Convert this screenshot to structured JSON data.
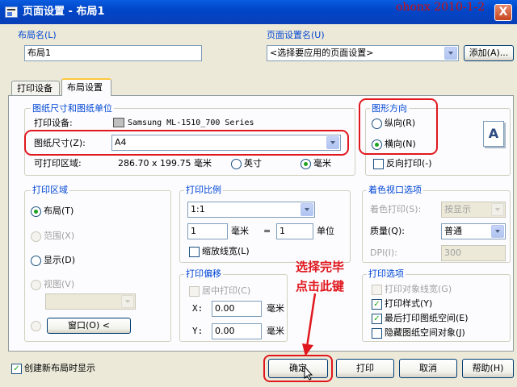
{
  "window": {
    "title": "页面设置 - 布局1",
    "watermark": "ohonx 2010-1-2",
    "close_glyph": "X"
  },
  "layout_name": {
    "label": "布局名(L)",
    "value": "布局1"
  },
  "page_setup_name": {
    "label": "页面设置名(U)",
    "selected": "<选择要应用的页面设置>",
    "add_button": "添加(A)..."
  },
  "tabs": [
    {
      "label": "打印设备",
      "active": false
    },
    {
      "label": "布局设置",
      "active": true
    }
  ],
  "paper": {
    "group_label": "图纸尺寸和图纸单位",
    "device_label": "打印设备:",
    "device_value": "Samsung ML-1510_700 Series",
    "size_label": "图纸尺寸(Z):",
    "size_value": "A4",
    "printable_label": "可打印区域:",
    "printable_value": "286.70 x 199.75 毫米",
    "unit_inch": "英寸",
    "unit_mm": "毫米",
    "selected_unit": "mm"
  },
  "orientation": {
    "group_label": "图形方向",
    "portrait": "纵向(R)",
    "landscape": "横向(N)",
    "selected": "landscape",
    "reverse": "反向打印(-)",
    "preview_glyph": "A"
  },
  "print_area": {
    "group_label": "打印区域",
    "options": [
      "布局(T)",
      "范围(X)",
      "显示(D)",
      "视图(V)"
    ],
    "selected": "布局(T)",
    "window_button": "窗口(O) <"
  },
  "print_scale": {
    "group_label": "打印比例",
    "ratio": "1:1",
    "value1": "1",
    "unit1": "毫米",
    "equals": "=",
    "value2": "1",
    "unit2": "单位",
    "scale_lineweights": "缩放线宽(L)"
  },
  "offset": {
    "group_label": "打印偏移",
    "center": "居中打印(C)",
    "x_label": "X:",
    "x_value": "0.00",
    "y_label": "Y:",
    "y_value": "0.00",
    "unit": "毫米"
  },
  "shaded": {
    "group_label": "着色视口选项",
    "shade_label": "着色打印(S):",
    "shade_value": "按显示",
    "quality_label": "质量(Q):",
    "quality_value": "普通",
    "dpi_label": "DPI(I):",
    "dpi_value": "300"
  },
  "plot_options": {
    "group_label": "打印选项",
    "items": [
      {
        "label": "打印对象线宽(G)",
        "checked": false,
        "enabled": false
      },
      {
        "label": "打印样式(Y)",
        "checked": true,
        "enabled": true
      },
      {
        "label": "最后打印图纸空间(E)",
        "checked": true,
        "enabled": true
      },
      {
        "label": "隐藏图纸空间对象(J)",
        "checked": false,
        "enabled": true
      }
    ]
  },
  "annotation": {
    "line1": "选择完毕",
    "line2": "点击此键"
  },
  "footer": {
    "show_on_create": "创建新布局时显示",
    "ok": "确定",
    "print": "打印",
    "cancel": "取消",
    "help": "帮助(H)"
  },
  "colors": {
    "accent_red": "#e0181e",
    "title_blue": "#0046c8"
  }
}
